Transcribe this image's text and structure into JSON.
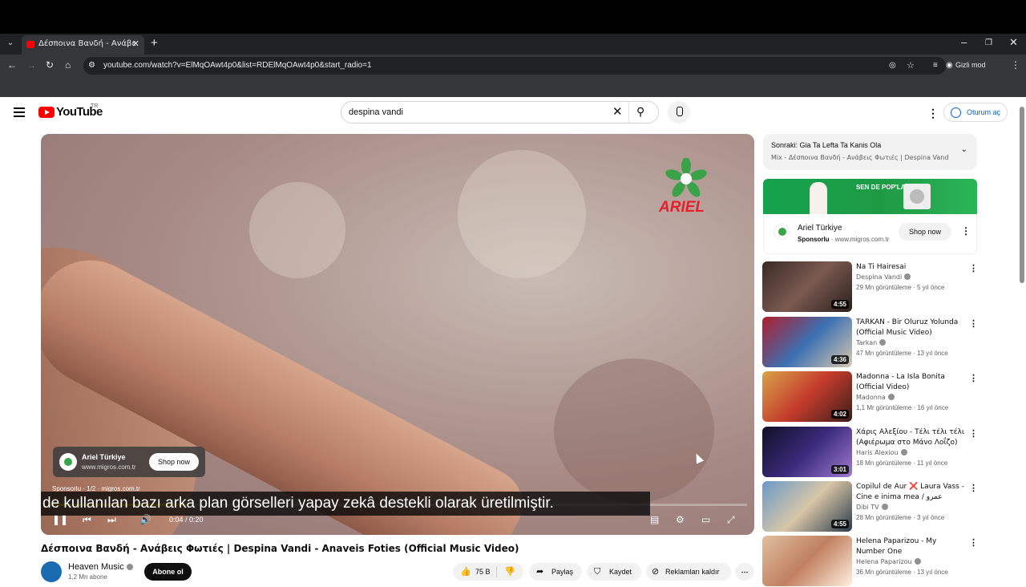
{
  "browser": {
    "tab_title": "Δέσποινα Βανδή - Ανάβεις Φωτιές",
    "url": "youtube.com/watch?v=ElMqOAwt4p0&list=RDElMqOAwt4p0&start_radio=1",
    "guest_label": "Gizli mod"
  },
  "header": {
    "logo_text": "YouTube",
    "country": "TR",
    "search_value": "despina vandi",
    "signin_label": "Oturum aç"
  },
  "player": {
    "brand_text": "ARIEL",
    "ad_name": "Ariel Türkiye",
    "ad_domain": "www.migros.com.tr",
    "ad_button": "Shop now",
    "sponsor_line": "Sponsorlu · 1/2 · migros.com.tr",
    "subtitle": "de kullanılan bazı arka plan görselleri yapay zekâ destekli olarak üretilmiştir.",
    "time": "0:04 / 0:20",
    "progress_fraction": 0.2
  },
  "video": {
    "title": "Δέσποινα Βανδή - Ανάβεις Φωτιές | Despina Vandi - Anaveis Foties (Official Music Video)",
    "channel": "Heaven Music",
    "subscribers": "1,2 Mn abone",
    "subscribe_label": "Abone ol",
    "likes": "75 B",
    "share_label": "Paylaş",
    "save_label": "Kaydet",
    "remove_ads_label": "Reklamları kaldır"
  },
  "upnext": {
    "title": "Sonraki: Gia Ta Lefta Ta Kanis Ola",
    "subtitle": "Mix - Δέσποινα Βανδή - Ανάβεις Φωτιές | Despina Vandi - A..."
  },
  "sidebar_ad": {
    "banner_text": "SEN DE POP'LA",
    "name": "Ariel Türkiye",
    "sponsored": "Sponsorlu",
    "domain": "www.migros.com.tr",
    "button": "Shop now"
  },
  "recommendations": [
    {
      "title": "Na Ti Hairesai",
      "channel": "Despina Vandi",
      "stats": "29 Mn görüntüleme · 5 yıl önce",
      "duration": "4:55"
    },
    {
      "title": "TARKAN - Bir Oluruz Yolunda (Official Music Video)",
      "channel": "Tarkan",
      "stats": "47 Mn görüntüleme · 13 yıl önce",
      "duration": "4:36"
    },
    {
      "title": "Madonna - La Isla Bonita (Official Video)",
      "channel": "Madonna",
      "stats": "1,1 Mr görüntüleme · 16 yıl önce",
      "duration": "4:02"
    },
    {
      "title": "Χάρις Αλεξίου - Τέλι τέλι τέλι (Αφιέρωμα στο Μάνο Λοΐζο)",
      "channel": "Haris Alexiou",
      "stats": "18 Mn görüntüleme · 11 yıl önce",
      "duration": "3:01"
    },
    {
      "title": "Copilul de Aur ❌ Laura Vass - Cine e inima mea / عمرو دياب...",
      "channel": "Dibi TV",
      "stats": "28 Mn görüntüleme · 3 yıl önce",
      "duration": "4:55"
    },
    {
      "title": "Helena Paparizou - My Number One",
      "channel": "Helena Paparizou",
      "stats": "36 Mn görüntüleme · 13 yıl önce",
      "duration": ""
    }
  ],
  "colors": {
    "youtube_red": "#ff0000",
    "link_blue": "#065fd4",
    "ariel_green": "#15a34c",
    "progress_yellow": "#ffcc00"
  }
}
